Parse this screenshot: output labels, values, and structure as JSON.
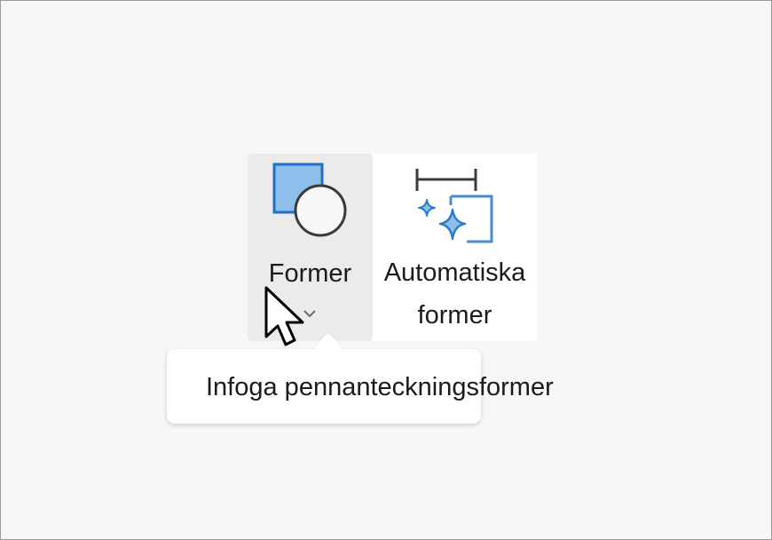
{
  "ribbon": {
    "shapes_button": {
      "label": "Former",
      "icon": "shapes-icon",
      "dropdown_icon": "chevron-down-icon"
    },
    "auto_shapes_button": {
      "label_line1": "Automatiska",
      "label_line2": "former",
      "icon": "auto-shapes-icon"
    }
  },
  "tooltip": {
    "text": "Infoga pennanteckningsformer"
  },
  "cursor": {
    "icon": "mouse-pointer-icon"
  },
  "colors": {
    "accent_blue": "#1e6fc8",
    "accent_blue_fill": "#8ebfea",
    "hover_bg": "#edebe9",
    "text": "#1b1b1b"
  }
}
